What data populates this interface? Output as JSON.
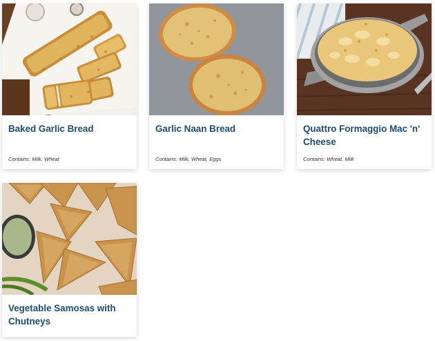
{
  "menu_items": [
    {
      "name": "Baked Garlic Bread",
      "allergens": "Contains: Milk, Wheat"
    },
    {
      "name": "Garlic Naan Bread",
      "allergens": "Contains: Milk, Wheat, Eggs"
    },
    {
      "name": "Quattro Formaggio Mac 'n' Cheese",
      "allergens": "Contains: Wheat, Milk"
    },
    {
      "name": "Vegetable Samosas with Chutneys"
    }
  ],
  "colors": {
    "title": "#1d4c6c",
    "allergen_text": "#2e2e2e",
    "card_background": "#ffffff"
  }
}
